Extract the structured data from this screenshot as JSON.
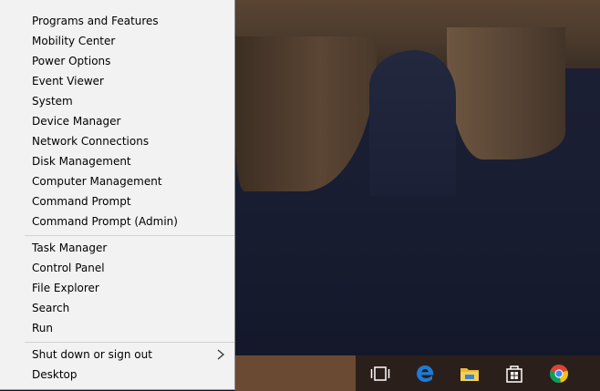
{
  "menu": {
    "group1": [
      "Programs and Features",
      "Mobility Center",
      "Power Options",
      "Event Viewer",
      "System",
      "Device Manager",
      "Network Connections",
      "Disk Management",
      "Computer Management",
      "Command Prompt",
      "Command Prompt (Admin)"
    ],
    "group2": [
      "Task Manager",
      "Control Panel",
      "File Explorer",
      "Search",
      "Run"
    ],
    "group3": [
      "Shut down or sign out",
      "Desktop"
    ]
  },
  "taskbar": {
    "icons": [
      "task-view-icon",
      "edge-icon",
      "file-explorer-icon",
      "store-icon",
      "chrome-icon"
    ]
  },
  "colors": {
    "menu_bg": "#f2f2f2",
    "taskbar": "#2a1f1a",
    "edge_blue": "#1e7bd6"
  }
}
